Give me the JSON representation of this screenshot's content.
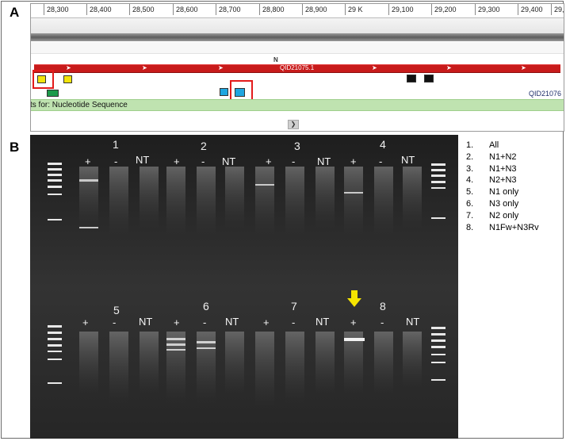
{
  "panel_a": {
    "label": "A",
    "ruler_ticks": [
      "28,300",
      "28,400",
      "28,500",
      "28,600",
      "28,700",
      "28,800",
      "28,900",
      "29 K",
      "29,100",
      "29,200",
      "29,300",
      "29,400",
      "29,5"
    ],
    "gene_symbol": "N",
    "gene_name": "QID21075.1",
    "right_track_label": "QID21076",
    "sequence_track_label": "ts for: Nucleotide Sequence",
    "colors": {
      "gene": "#c81b1b",
      "highlight": "#e31b1b",
      "track": "#bfe3b0",
      "yellow": "#f2e40c",
      "blue": "#1fa6e0",
      "green": "#1c9a4a"
    }
  },
  "panel_b": {
    "label": "B",
    "top_groups": [
      "1",
      "2",
      "3",
      "4"
    ],
    "bottom_groups": [
      "5",
      "6",
      "7",
      "8"
    ],
    "lane_marks_top": [
      "+",
      "-",
      "NT",
      "+",
      "-",
      "NT",
      "+",
      "-",
      "NT",
      "+",
      "-",
      "NT"
    ],
    "lane_marks_bottom": [
      "+",
      "-",
      "NT",
      "+",
      "-",
      "NT",
      "+",
      "-",
      "NT",
      "+",
      "-",
      "NT"
    ],
    "legend": [
      {
        "num": "1.",
        "text": "All"
      },
      {
        "num": "2.",
        "text": "N1+N2"
      },
      {
        "num": "3.",
        "text": "N1+N3"
      },
      {
        "num": "4.",
        "text": "N2+N3"
      },
      {
        "num": "5.",
        "text": "N1 only"
      },
      {
        "num": "6.",
        "text": "N3 only"
      },
      {
        "num": "7.",
        "text": "N2 only"
      },
      {
        "num": "8.",
        "text": "N1Fw+N3Rv"
      }
    ],
    "arrow_color": "#f5e400"
  }
}
